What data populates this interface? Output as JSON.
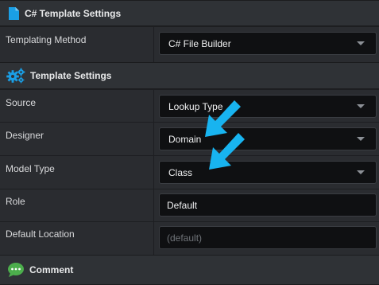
{
  "csharp_section": {
    "title": "C# Template Settings",
    "icon": "file-icon"
  },
  "templating_method": {
    "label": "Templating Method",
    "value": "C# File Builder"
  },
  "template_section": {
    "title": "Template Settings",
    "icon": "gears-icon"
  },
  "source": {
    "label": "Source",
    "value": "Lookup Type"
  },
  "designer": {
    "label": "Designer",
    "value": "Domain"
  },
  "model_type": {
    "label": "Model Type",
    "value": "Class"
  },
  "role": {
    "label": "Role",
    "value": "Default"
  },
  "default_location": {
    "label": "Default Location",
    "placeholder": "(default)"
  },
  "comment_section": {
    "title": "Comment",
    "icon": "speech-bubble-icon"
  },
  "colors": {
    "accent_blue": "#1a9fe6",
    "arrow_cyan": "#18b4f0",
    "comment_green": "#4cae4c"
  }
}
